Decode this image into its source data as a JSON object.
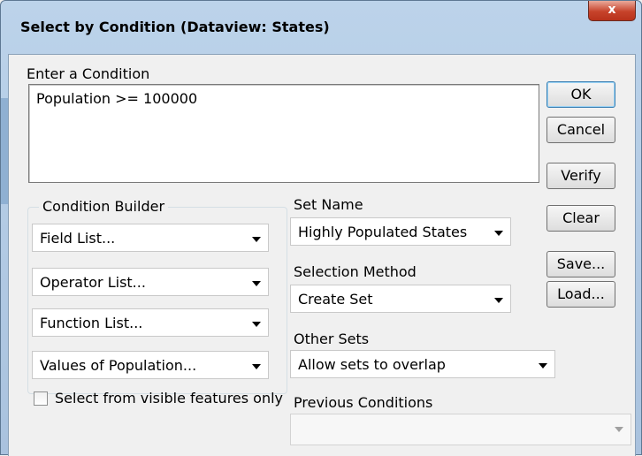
{
  "window": {
    "title": "Select by Condition (Dataview: States)",
    "close_glyph": "x"
  },
  "condition": {
    "label": "Enter a Condition",
    "value": "Population >= 100000"
  },
  "buttons": {
    "ok": "OK",
    "cancel": "Cancel",
    "verify": "Verify",
    "clear": "Clear",
    "save": "Save...",
    "load": "Load..."
  },
  "condition_builder": {
    "title": "Condition Builder",
    "field_list": "Field List...",
    "operator_list": "Operator List...",
    "function_list": "Function List...",
    "values_list": "Values of Population..."
  },
  "set_name": {
    "label": "Set Name",
    "value": "Highly Populated States"
  },
  "selection_method": {
    "label": "Selection Method",
    "value": "Create Set"
  },
  "other_sets": {
    "label": "Other Sets",
    "value": "Allow sets to overlap"
  },
  "previous_conditions": {
    "label": "Previous Conditions",
    "value": ""
  },
  "visible_only": {
    "label": "Select from visible features only",
    "checked": false
  }
}
